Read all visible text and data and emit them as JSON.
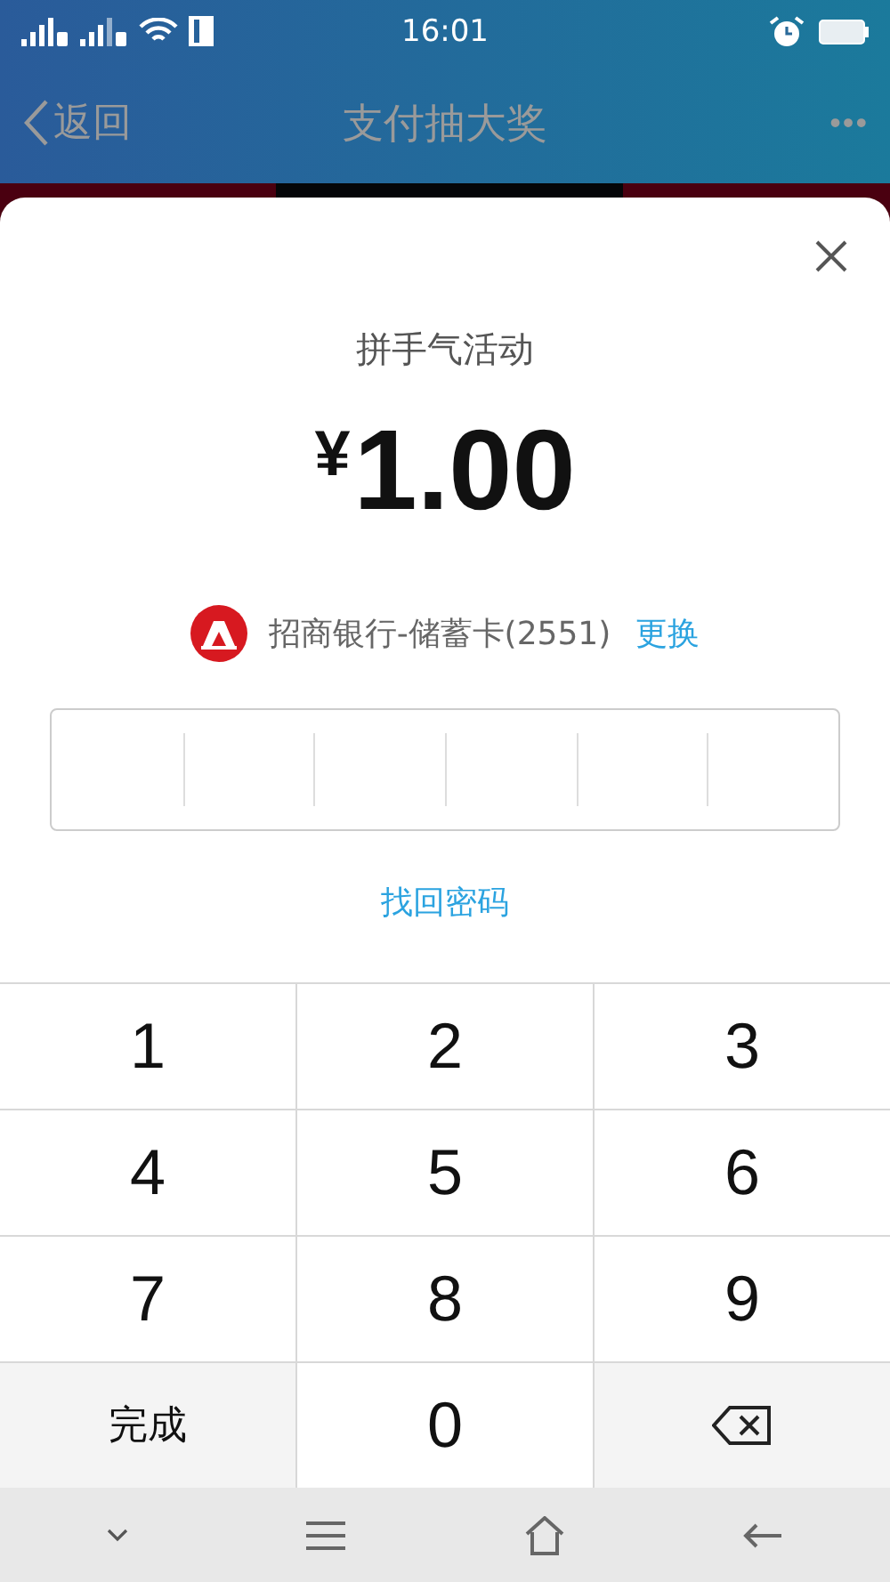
{
  "status_bar": {
    "time": "16:01"
  },
  "nav_bar": {
    "back_label": "返回",
    "title": "支付抽大奖",
    "more": "•••"
  },
  "payment_sheet": {
    "title": "拼手气活动",
    "currency": "¥",
    "amount": "1.00",
    "card": "招商银行-储蓄卡(2551)",
    "change_link": "更换",
    "forgot_link": "找回密码"
  },
  "keypad": [
    {
      "kind": "digit",
      "label": "1"
    },
    {
      "kind": "digit",
      "label": "2"
    },
    {
      "kind": "digit",
      "label": "3"
    },
    {
      "kind": "digit",
      "label": "4"
    },
    {
      "kind": "digit",
      "label": "5"
    },
    {
      "kind": "digit",
      "label": "6"
    },
    {
      "kind": "digit",
      "label": "7"
    },
    {
      "kind": "digit",
      "label": "8"
    },
    {
      "kind": "digit",
      "label": "9"
    },
    {
      "kind": "text",
      "label": "完成"
    },
    {
      "kind": "digit",
      "label": "0"
    },
    {
      "kind": "delete"
    }
  ]
}
